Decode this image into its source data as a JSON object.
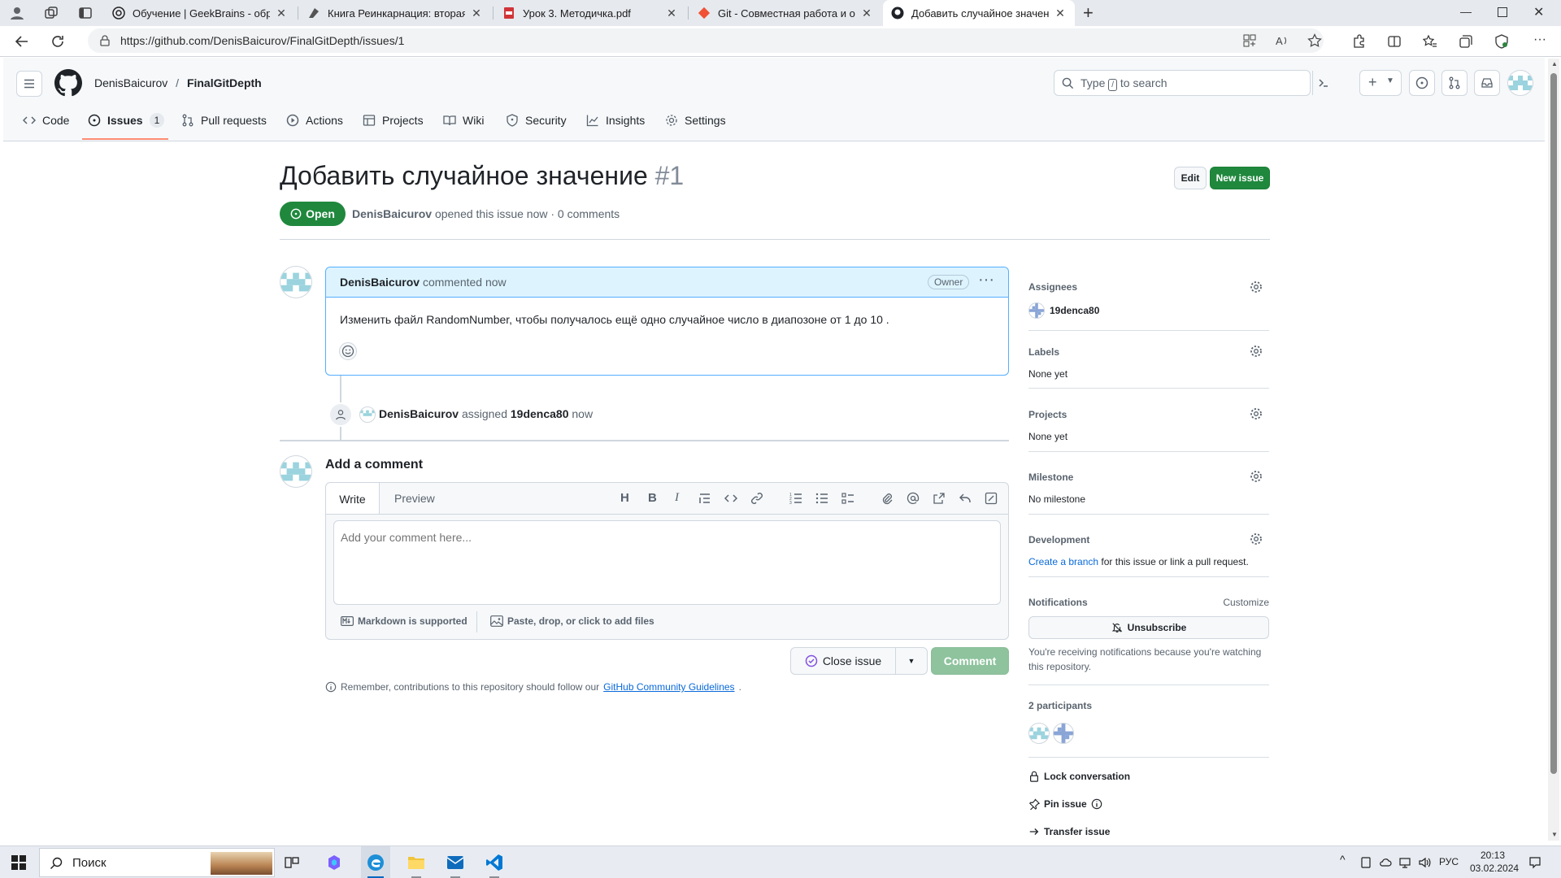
{
  "browser": {
    "tabs": [
      {
        "title": "Обучение | GeekBrains - образо"
      },
      {
        "title": "Книга Реинкарнация: вторая ж"
      },
      {
        "title": "Урок 3. Методичка.pdf"
      },
      {
        "title": "Git - Совместная работа и обно"
      },
      {
        "title": "Добавить случайное значение"
      }
    ],
    "url": "https://github.com/DenisBaicurov/FinalGitDepth/issues/1"
  },
  "repo": {
    "owner": "DenisBaicurov",
    "name": "FinalGitDepth",
    "sep": "/"
  },
  "search": {
    "prefix": "Type",
    "key": "/",
    "suffix": "to search"
  },
  "nav": {
    "code": "Code",
    "issues": "Issues",
    "issues_count": "1",
    "pulls": "Pull requests",
    "actions": "Actions",
    "projects": "Projects",
    "wiki": "Wiki",
    "security": "Security",
    "insights": "Insights",
    "settings": "Settings"
  },
  "issue": {
    "title": "Добавить случайное значение",
    "number": "#1",
    "state": "Open",
    "author": "DenisBaicurov",
    "meta": "opened this issue now · 0 comments",
    "edit_label": "Edit",
    "new_issue_label": "New issue"
  },
  "comment": {
    "author": "DenisBaicurov",
    "time": "commented now",
    "role": "Owner",
    "body": "Изменить файл RandomNumber, чтобы получалось ещё одно случайное число в диапозоне от 1 до 10 ."
  },
  "event": {
    "actor": "DenisBaicurov",
    "action": "assigned",
    "target": "19denca80",
    "time": "now"
  },
  "composer": {
    "heading": "Add a comment",
    "tab_write": "Write",
    "tab_preview": "Preview",
    "placeholder": "Add your comment here...",
    "markdown": "Markdown is supported",
    "attach": "Paste, drop, or click to add files",
    "close_issue": "Close issue",
    "comment_btn": "Comment",
    "guidelines_prefix": "Remember, contributions to this repository should follow our",
    "guidelines_link": "GitHub Community Guidelines",
    "guidelines_suffix": "."
  },
  "sidebar": {
    "assignees": {
      "label": "Assignees",
      "value": "19denca80"
    },
    "labels": {
      "label": "Labels",
      "value": "None yet"
    },
    "projects": {
      "label": "Projects",
      "value": "None yet"
    },
    "milestone": {
      "label": "Milestone",
      "value": "No milestone"
    },
    "development": {
      "label": "Development",
      "link1": "Create a branch",
      "mid": "for this issue or",
      "link2": "link a pull request",
      "end": "."
    },
    "notifications": {
      "label": "Notifications",
      "customize": "Customize",
      "unsubscribe": "Unsubscribe",
      "note": "You're receiving notifications because you're watching this repository."
    },
    "participants": {
      "label": "2 participants"
    },
    "lock": "Lock conversation",
    "pin": "Pin issue",
    "transfer": "Transfer issue"
  },
  "taskbar": {
    "search": "Поиск",
    "lang": "РУС",
    "time": "20:13",
    "date": "03.02.2024"
  },
  "colors": {
    "green": "#1f883d",
    "link": "#0969da",
    "comment_header": "#ddf4ff"
  }
}
